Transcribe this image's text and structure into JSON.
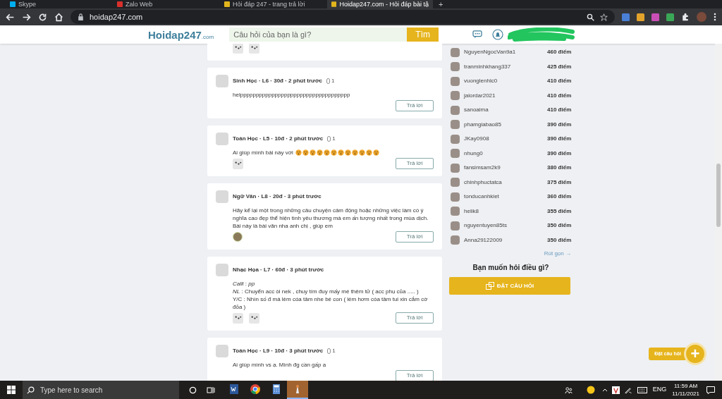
{
  "browser": {
    "tabs": [
      {
        "title": "Skype",
        "selected": false
      },
      {
        "title": "Zalo Web",
        "selected": false
      },
      {
        "title": "Hỏi đáp 247 - trang trả lời",
        "selected": false
      },
      {
        "title": "Hoidap247.com - Hỏi đáp bài tậ",
        "selected": true
      }
    ],
    "url": "hoidap247.com"
  },
  "header": {
    "logo": "Hoidap247",
    "logo_suffix": ".com",
    "search": {
      "placeholder": "Câu hỏi của bạn là gì?"
    },
    "search_button": "Tìm"
  },
  "questions": [
    {
      "attachments": [
        {
          "kind": "sketch"
        },
        {
          "kind": "sketch"
        }
      ]
    },
    {
      "meta": "Sinh Học · L6 · 30đ · 2 phút trước",
      "answers": "1",
      "body": [
        "helppppppppppppppppppppppppppppppppppp"
      ],
      "reply": "Trả lời"
    },
    {
      "meta": "Toán Học · L5 · 10đ · 2 phút trước",
      "answers": "1",
      "body": [
        "Ai giúp mình bài này với"
      ],
      "emojis": [
        {
          "kind": "face"
        },
        {
          "kind": "face"
        },
        {
          "kind": "face"
        },
        {
          "kind": "face"
        },
        {
          "kind": "face"
        },
        {
          "kind": "face"
        },
        {
          "kind": "face"
        },
        {
          "kind": "face"
        },
        {
          "kind": "face"
        },
        {
          "kind": "face"
        },
        {
          "kind": "face"
        },
        {
          "kind": "face"
        }
      ],
      "attachments": [
        {
          "kind": "sketch"
        }
      ],
      "reply": "Trả lời"
    },
    {
      "meta": "Ngữ Văn · L8 · 20đ · 3 phút trước",
      "body": [
        "Hãy kể lại một trong những câu chuyện cảm động hoặc những việc làm có ý nghĩa cao đẹp thể hiện tình yêu thương mà em ấn tượng nhất trong mùa dịch.",
        "Bài này là bài văn nha anh chị , giúp em"
      ],
      "attachments": [
        {
          "kind": "photo"
        }
      ],
      "reply": "Trả lời"
    },
    {
      "meta": "Nhạc Họa · L7 · 60đ · 3 phút trước",
      "body": [
        "*Calli* : *pp*",
        "*NL* : Chuyển acc òi nek , chuy tím đuy mấy mé thêm tử ( acc phụ của ..... )",
        "Y/C : Nhìn số đ mà lèm cóa tâm nhe bé con ( lèm hơm cóa tâm tui xin cắm cờ đỏa )"
      ],
      "attachments": [
        {
          "kind": "sketch"
        },
        {
          "kind": "sketch"
        }
      ],
      "reply": "Trả lời"
    },
    {
      "meta": "Toán Học · L9 · 10đ · 3 phút trước",
      "answers": "1",
      "body": [
        "Ai giúp mình vs ạ. Mình đg cần gấp ạ"
      ],
      "reply": "Trả lời"
    }
  ],
  "leaderboard": {
    "rows": [
      {
        "name": "NguyenNgocVan9a1",
        "score": "460 điểm"
      },
      {
        "name": "tranminhkhang337",
        "score": "425 điểm"
      },
      {
        "name": "vuonglenhlc0",
        "score": "410 điểm"
      },
      {
        "name": "jalordar2021",
        "score": "410 điểm"
      },
      {
        "name": "sanoaima",
        "score": "410 điểm"
      },
      {
        "name": "phamgiabao85",
        "score": "390 điểm"
      },
      {
        "name": "JKay0908",
        "score": "390 điểm"
      },
      {
        "name": "nhung0",
        "score": "390 điểm"
      },
      {
        "name": "fansimsam2k9",
        "score": "380 điểm"
      },
      {
        "name": "chinhphuctatca",
        "score": "375 điểm"
      },
      {
        "name": "tonducanhkiet",
        "score": "360 điểm"
      },
      {
        "name": "helik8",
        "score": "355 điểm"
      },
      {
        "name": "nguyentuyen85ts",
        "score": "350 điểm"
      },
      {
        "name": "Anna29122009",
        "score": "350 điểm"
      }
    ],
    "collapse_link": "Rút gọn →"
  },
  "ask": {
    "heading": "Bạn muốn hỏi điều gì?",
    "button": "ĐẶT CÂU HỎI"
  },
  "floating_ask": {
    "label": "Đặt câu hỏi",
    "icon": "+"
  },
  "taskbar": {
    "search": {
      "placeholder": "Type here to search"
    },
    "apps": [
      {
        "kind": "word",
        "selected": false
      },
      {
        "kind": "chrome",
        "selected": false
      },
      {
        "kind": "calculator",
        "selected": false
      },
      {
        "kind": "app",
        "selected": true
      }
    ],
    "language": "ENG",
    "time": "11:59 AM",
    "date": "11/11/2021"
  }
}
